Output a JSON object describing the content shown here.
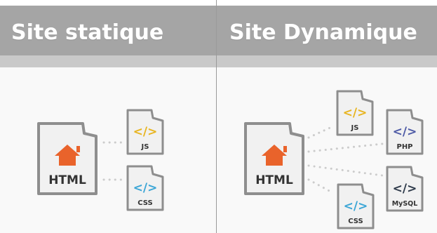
{
  "static_site": {
    "title": "Site statique",
    "main_file": "HTML",
    "files": [
      {
        "glyph": "</>",
        "label": "JS",
        "color": "#e8b521"
      },
      {
        "glyph": "</>",
        "label": "CSS",
        "color": "#3ba6d6"
      }
    ]
  },
  "dynamic_site": {
    "title": "Site Dynamique",
    "main_file": "HTML",
    "files": [
      {
        "glyph": "</>",
        "label": "JS",
        "color": "#e8b521"
      },
      {
        "glyph": "</>",
        "label": "PHP",
        "color": "#4e5ba6"
      },
      {
        "glyph": "</>",
        "label": "MySQL",
        "color": "#2e3a4a"
      },
      {
        "glyph": "</>",
        "label": "CSS",
        "color": "#3ba6d6"
      }
    ]
  },
  "colors": {
    "header": "#a5a5a5",
    "home_icon": "#e9632b",
    "file_outline": "#8e8e8e",
    "connector": "#cccccc"
  }
}
